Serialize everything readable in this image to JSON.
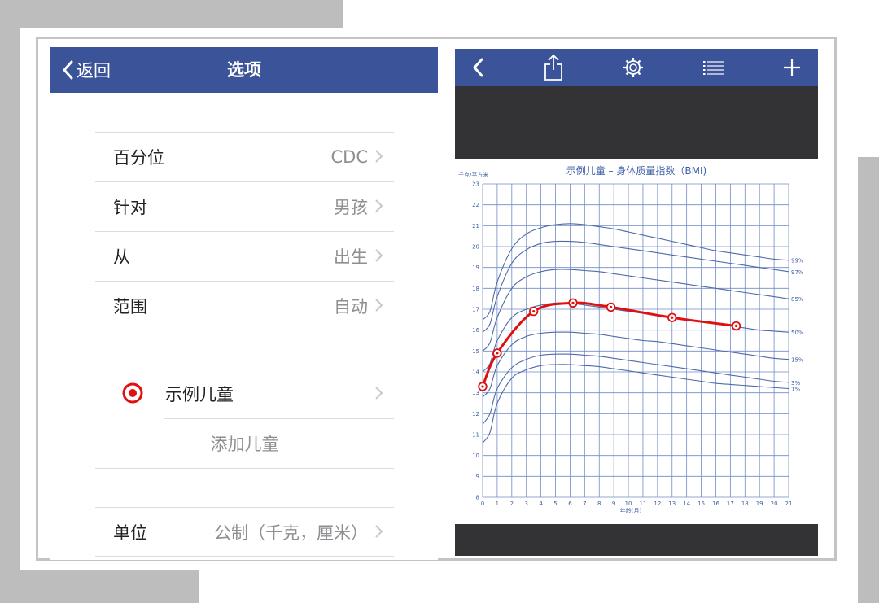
{
  "left": {
    "nav": {
      "back_label": "返回",
      "title": "选项"
    },
    "rows": [
      {
        "label": "百分位",
        "value": "CDC"
      },
      {
        "label": "针对",
        "value": "男孩"
      },
      {
        "label": "从",
        "value": "出生"
      },
      {
        "label": "范围",
        "value": "自动"
      }
    ],
    "child": {
      "name": "示例儿童",
      "add_label": "添加儿童"
    },
    "units": {
      "label": "单位",
      "value": "公制（千克，厘米）"
    }
  },
  "right": {
    "toolbar_icons": [
      "back-icon",
      "share-icon",
      "gear-icon",
      "list-icon",
      "plus-icon"
    ],
    "chart_title": "示例儿童 – 身体质量指数（BMI)",
    "y_unit": "千克/平方米",
    "x_unit": "年龄(月)"
  },
  "colors": {
    "nav": "#3b5499",
    "grid": "#6f8cc8",
    "curve": "#4f6aa8",
    "patient": "#e01010"
  },
  "chart_data": {
    "type": "line",
    "title": "示例儿童 – 身体质量指数（BMI)",
    "xlabel": "年龄(月)",
    "ylabel": "千克/平方米",
    "xlim": [
      0,
      21
    ],
    "ylim": [
      8,
      23
    ],
    "x_ticks": [
      0,
      1,
      2,
      3,
      4,
      5,
      6,
      7,
      8,
      9,
      10,
      11,
      12,
      13,
      14,
      15,
      16,
      17,
      18,
      19,
      20,
      21
    ],
    "y_ticks": [
      8,
      9,
      10,
      11,
      12,
      13,
      14,
      15,
      16,
      17,
      18,
      19,
      20,
      21,
      22,
      23
    ],
    "grid": true,
    "x": [
      0,
      0.5,
      1,
      2,
      3,
      4,
      5,
      6,
      7,
      8,
      9,
      10,
      11,
      12,
      13,
      14,
      15,
      16,
      17,
      18,
      19,
      20,
      21
    ],
    "series": [
      {
        "name": "99%",
        "values": [
          16.5,
          16.9,
          18.3,
          19.9,
          20.6,
          20.9,
          21.05,
          21.1,
          21.05,
          20.95,
          20.85,
          20.7,
          20.55,
          20.4,
          20.25,
          20.1,
          19.95,
          19.8,
          19.7,
          19.6,
          19.5,
          19.4,
          19.35
        ]
      },
      {
        "name": "97%",
        "values": [
          15.9,
          16.3,
          17.6,
          19.2,
          19.85,
          20.15,
          20.25,
          20.25,
          20.2,
          20.1,
          20.0,
          19.9,
          19.8,
          19.7,
          19.6,
          19.5,
          19.4,
          19.3,
          19.2,
          19.1,
          19.0,
          18.9,
          18.8
        ]
      },
      {
        "name": "85%",
        "values": [
          15.0,
          15.4,
          16.6,
          18.0,
          18.55,
          18.8,
          18.9,
          18.9,
          18.85,
          18.8,
          18.7,
          18.6,
          18.5,
          18.4,
          18.3,
          18.2,
          18.1,
          18.0,
          17.9,
          17.8,
          17.7,
          17.6,
          17.5
        ]
      },
      {
        "name": "50%",
        "values": [
          14.0,
          14.4,
          15.5,
          16.6,
          17.0,
          17.2,
          17.3,
          17.3,
          17.2,
          17.1,
          17.0,
          16.9,
          16.8,
          16.7,
          16.6,
          16.5,
          16.4,
          16.3,
          16.2,
          16.1,
          16.0,
          15.95,
          15.9
        ]
      },
      {
        "name": "15%",
        "values": [
          12.8,
          13.2,
          14.3,
          15.3,
          15.7,
          15.85,
          15.9,
          15.9,
          15.85,
          15.8,
          15.7,
          15.6,
          15.5,
          15.45,
          15.35,
          15.25,
          15.15,
          15.05,
          14.95,
          14.85,
          14.75,
          14.65,
          14.6
        ]
      },
      {
        "name": "3%",
        "values": [
          11.5,
          12.0,
          13.2,
          14.2,
          14.6,
          14.8,
          14.85,
          14.85,
          14.8,
          14.75,
          14.65,
          14.55,
          14.45,
          14.35,
          14.25,
          14.15,
          14.05,
          13.95,
          13.85,
          13.75,
          13.65,
          13.55,
          13.5
        ]
      },
      {
        "name": "1%",
        "values": [
          10.6,
          11.1,
          12.5,
          13.7,
          14.1,
          14.3,
          14.35,
          14.35,
          14.3,
          14.25,
          14.15,
          14.05,
          13.95,
          13.85,
          13.75,
          13.65,
          13.55,
          13.45,
          13.4,
          13.35,
          13.3,
          13.25,
          13.2
        ]
      }
    ],
    "patient": {
      "x": [
        0,
        1,
        3.5,
        6.2,
        8.8,
        13,
        17.4
      ],
      "y": [
        13.3,
        14.9,
        16.9,
        17.3,
        17.1,
        16.6,
        16.2
      ]
    },
    "percentile_labels": [
      "99%",
      "97%",
      "85%",
      "50%",
      "15%",
      "3%",
      "1%"
    ]
  }
}
